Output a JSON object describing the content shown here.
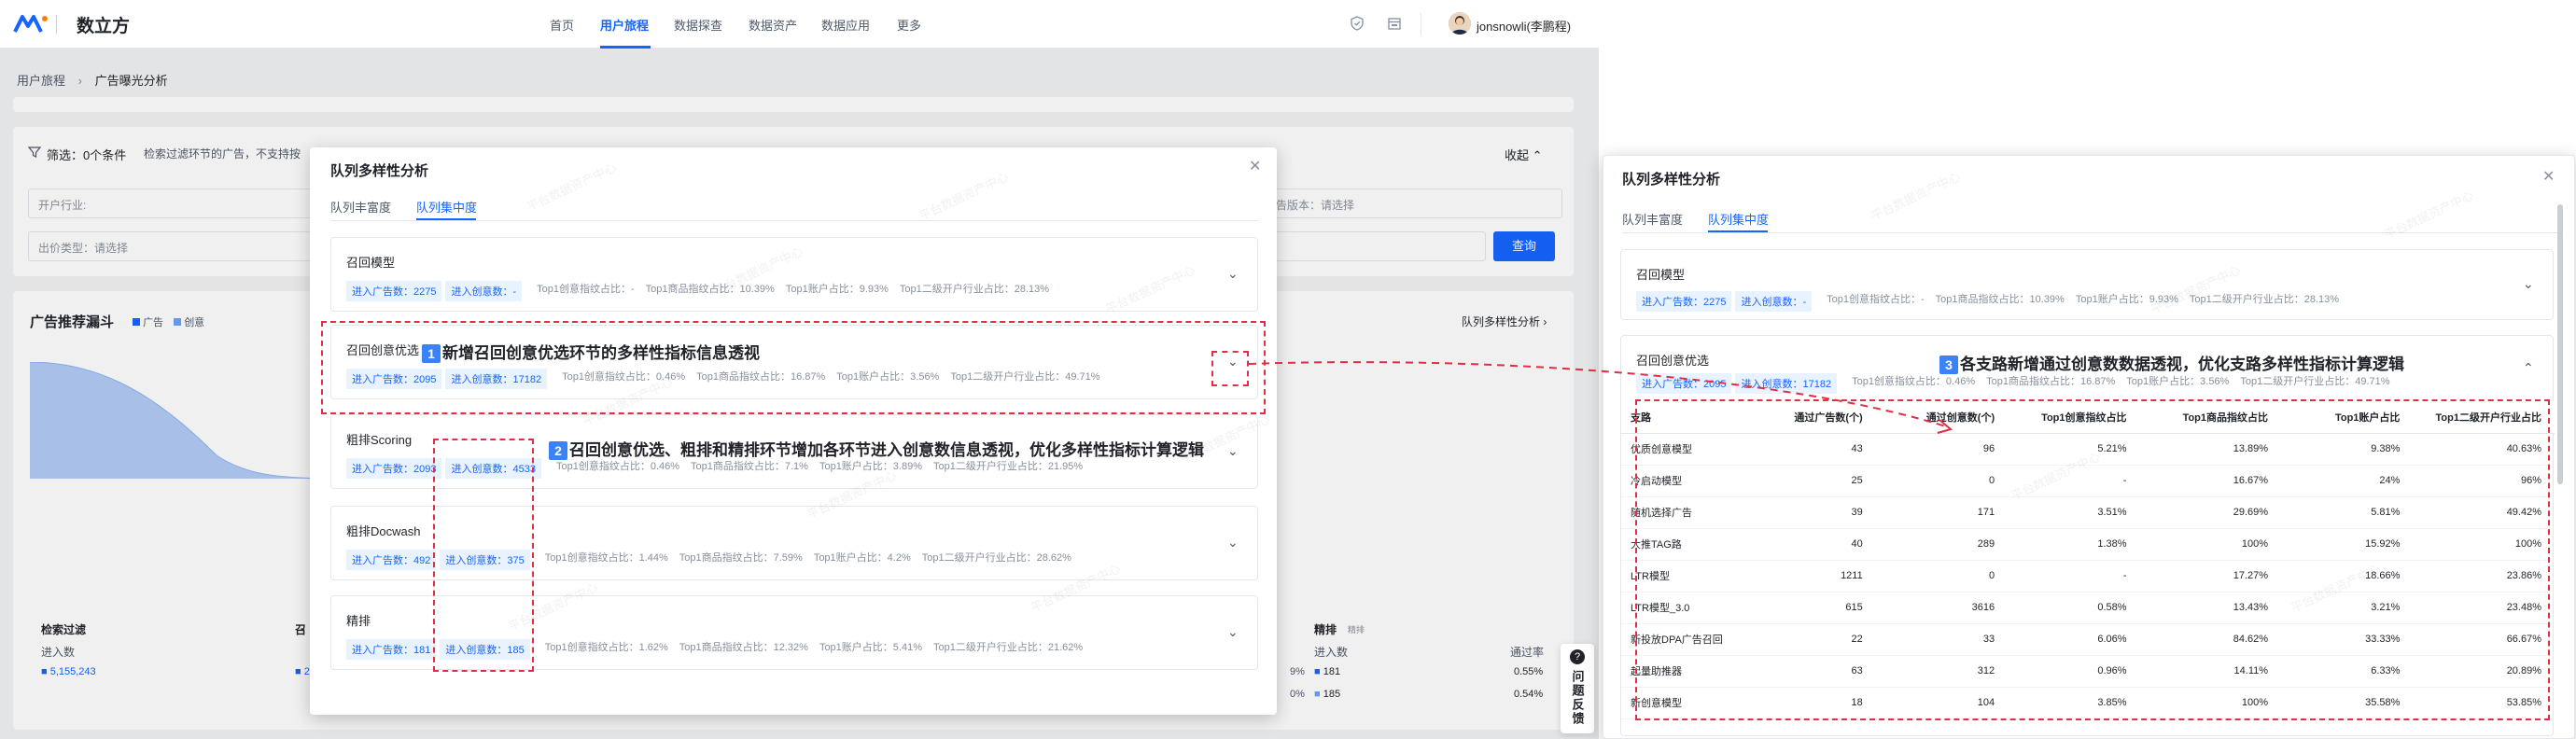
{
  "app": {
    "name": "数立方",
    "user": "jonsnowli(李鹏程)"
  },
  "nav": {
    "items": [
      "首页",
      "用户旅程",
      "数据探查",
      "数据资产",
      "数据应用",
      "更多"
    ],
    "active_index": 1
  },
  "breadcrumb": {
    "parent": "用户旅程",
    "current": "广告曝光分析"
  },
  "filter": {
    "label": "筛选：0个条件",
    "hint": "检索过滤环节的广告，不支持按",
    "collapse": "收起",
    "industry_placeholder": "开户行业:",
    "bid_placeholder": "出价类型：请选择",
    "version_placeholder": "广告版本：请选择",
    "query_button": "查询"
  },
  "funnel": {
    "title": "广告推荐漏斗",
    "legend": [
      "广告",
      "创意"
    ],
    "link": "队列多样性分析",
    "colors": {
      "ad": "#1664ff",
      "creative": "#6aa1ff"
    },
    "left_stage": {
      "title": "检索过滤",
      "sub": "进入数",
      "value": "5,155,243",
      "next_prefix": "召",
      "next_value": "2"
    },
    "right_stage": {
      "title": "精排",
      "tag": "精排",
      "sub": "进入数",
      "rate_header": "通过率",
      "rows": [
        {
          "value": "181",
          "rate": "0.55%"
        },
        {
          "value": "185",
          "rate": "0.54%"
        }
      ],
      "left_rates": [
        "9%",
        "0%"
      ]
    }
  },
  "feedback": {
    "label": "问题反馈"
  },
  "modal_left": {
    "title": "队列多样性分析",
    "tabs": [
      "队列丰富度",
      "队列集中度"
    ],
    "active_tab": 1,
    "stages": [
      {
        "title": "召回模型",
        "chips": [
          "进入广告数：2275",
          "进入创意数：-"
        ],
        "metrics": [
          "Top1创意指纹占比：-",
          "Top1商品指纹占比：10.39%",
          "Top1账户占比：9.93%",
          "Top1二级开户行业占比：28.13%"
        ]
      },
      {
        "title": "召回创意优选",
        "chips": [
          "进入广告数：2095",
          "进入创意数：17182"
        ],
        "metrics": [
          "Top1创意指纹占比：0.46%",
          "Top1商品指纹占比：16.87%",
          "Top1账户占比：3.56%",
          "Top1二级开户行业占比：49.71%"
        ]
      },
      {
        "title": "粗排Scoring",
        "chips": [
          "进入广告数：2093",
          "进入创意数：4533"
        ],
        "metrics": [
          "Top1创意指纹占比：0.46%",
          "Top1商品指纹占比：7.1%",
          "Top1账户占比：3.89%",
          "Top1二级开户行业占比：21.95%"
        ]
      },
      {
        "title": "粗排Docwash",
        "chips": [
          "进入广告数：492",
          "进入创意数：375"
        ],
        "metrics": [
          "Top1创意指纹占比：1.44%",
          "Top1商品指纹占比：7.59%",
          "Top1账户占比：4.2%",
          "Top1二级开户行业占比：28.62%"
        ]
      },
      {
        "title": "精排",
        "chips": [
          "进入广告数：181",
          "进入创意数：185"
        ],
        "metrics": [
          "Top1创意指纹占比：1.62%",
          "Top1商品指纹占比：12.32%",
          "Top1账户占比：5.41%",
          "Top1二级开户行业占比：21.62%"
        ]
      }
    ]
  },
  "annotations": {
    "a1": {
      "num": "1",
      "text": "新增召回创意优选环节的多样性指标信息透视"
    },
    "a2": {
      "num": "2",
      "text": "召回创意优选、粗排和精排环节增加各环节进入创意数信息透视，优化多样性指标计算逻辑"
    },
    "a3": {
      "num": "3",
      "text": "各支路新增通过创意数数据透视，优化支路多样性指标计算逻辑"
    }
  },
  "modal_right": {
    "title": "队列多样性分析",
    "tabs": [
      "队列丰富度",
      "队列集中度"
    ],
    "active_tab": 1,
    "stage1": {
      "title": "召回模型",
      "chips": [
        "进入广告数：2275",
        "进入创意数：-"
      ],
      "metrics": [
        "Top1创意指纹占比：-",
        "Top1商品指纹占比：10.39%",
        "Top1账户占比：9.93%",
        "Top1二级开户行业占比：28.13%"
      ]
    },
    "stage2": {
      "title": "召回创意优选",
      "chips": [
        "进入广告数：2095",
        "进入创意数：17182"
      ],
      "metrics": [
        "Top1创意指纹占比：0.46%",
        "Top1商品指纹占比：16.87%",
        "Top1账户占比：3.56%",
        "Top1二级开户行业占比：49.71%"
      ]
    },
    "table": {
      "columns": [
        "支路",
        "通过广告数(个)",
        "通过创意数(个)",
        "Top1创意指纹占比",
        "Top1商品指纹占比",
        "Top1账户占比",
        "Top1二级开户行业占比"
      ],
      "rows": [
        [
          "优质创意模型",
          "43",
          "96",
          "5.21%",
          "13.89%",
          "9.38%",
          "40.63%"
        ],
        [
          "冷启动模型",
          "25",
          "0",
          "-",
          "16.67%",
          "24%",
          "96%"
        ],
        [
          "随机选择广告",
          "39",
          "171",
          "3.51%",
          "29.69%",
          "5.81%",
          "49.42%"
        ],
        [
          "大推TAG路",
          "40",
          "289",
          "1.38%",
          "100%",
          "15.92%",
          "100%"
        ],
        [
          "LTR模型",
          "1211",
          "0",
          "-",
          "17.27%",
          "18.66%",
          "23.86%"
        ],
        [
          "LTR模型_3.0",
          "615",
          "3616",
          "0.58%",
          "13.43%",
          "3.21%",
          "23.48%"
        ],
        [
          "新投放DPA广告召回",
          "22",
          "33",
          "6.06%",
          "84.62%",
          "33.33%",
          "66.67%"
        ],
        [
          "起量助推器",
          "63",
          "312",
          "0.96%",
          "14.11%",
          "6.33%",
          "20.89%"
        ],
        [
          "新创意模型",
          "18",
          "104",
          "3.85%",
          "100%",
          "35.58%",
          "53.85%"
        ]
      ]
    }
  },
  "watermark": "平台数据资产中心"
}
